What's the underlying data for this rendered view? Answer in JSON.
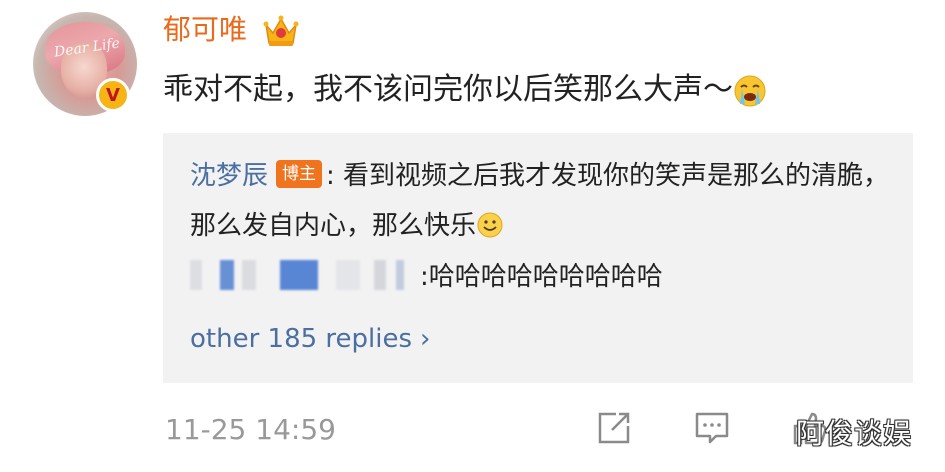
{
  "post": {
    "username": "郁可唯",
    "comment_text": "乖对不起，我不该问完你以后笑那么大声～",
    "avatar_script": "Dear Life"
  },
  "replies": {
    "first": {
      "user": "沈梦辰",
      "tag": "博主",
      "text": ": 看到视频之后我才发现你的笑声是那么的清脆，那么发自内心，那么快乐"
    },
    "second": {
      "text": ":哈哈哈哈哈哈哈哈哈"
    },
    "more_label": "other 185 replies",
    "more_chevron": "›"
  },
  "footer": {
    "timestamp": "11-25 14:59",
    "watermark": "阿俊谈娱"
  },
  "icons": {
    "verified_badge": "v-badge-icon",
    "crown": "crown-icon",
    "crying_emoji": "crying-emoji-icon",
    "smile_emoji": "smile-emoji-icon",
    "share": "share-icon",
    "comment": "comment-icon",
    "like": "thumbs-up-icon"
  },
  "colors": {
    "username": "#ea6a1c",
    "link": "#4a6fa0",
    "host_tag": "#f0731e",
    "verified": "#f6b515",
    "reply_bg": "#f2f2f2",
    "meta": "#999999"
  }
}
